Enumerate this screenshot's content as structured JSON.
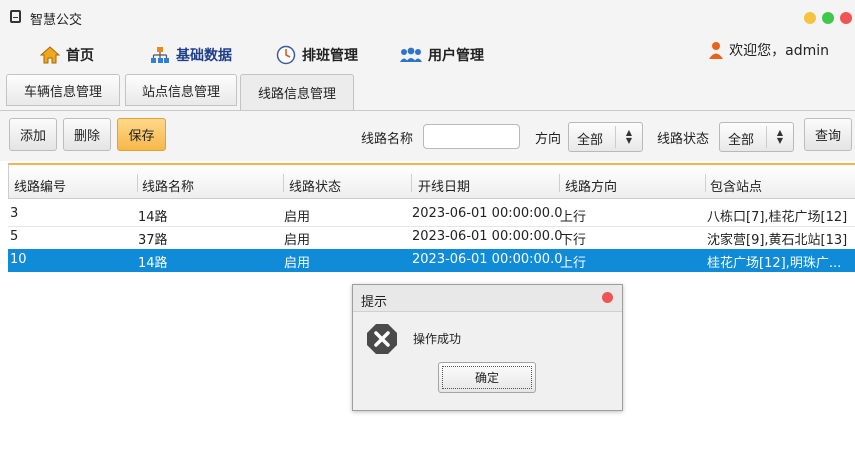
{
  "window": {
    "title": "智慧公交"
  },
  "nav": {
    "items": [
      {
        "label": "首页",
        "icon": "home-icon"
      },
      {
        "label": "基础数据",
        "icon": "sitemap-icon"
      },
      {
        "label": "排班管理",
        "icon": "clock-icon"
      },
      {
        "label": "用户管理",
        "icon": "users-icon"
      }
    ],
    "welcome": "欢迎您，admin"
  },
  "subtabs": [
    {
      "label": "车辆信息管理"
    },
    {
      "label": "站点信息管理"
    },
    {
      "label": "线路信息管理",
      "active": true
    }
  ],
  "toolbar": {
    "add_label": "添加",
    "delete_label": "删除",
    "save_label": "保存",
    "route_name_label": "线路名称",
    "route_name_value": "",
    "direction_label": "方向",
    "direction_value": "全部",
    "status_label": "线路状态",
    "status_value": "全部",
    "query_label": "查询"
  },
  "table": {
    "columns": [
      "线路编号",
      "线路名称",
      "线路状态",
      "开线日期",
      "线路方向",
      "包含站点"
    ],
    "rows": [
      [
        "3",
        "14路",
        "启用",
        "2023-06-01 00:00:00.0",
        "上行",
        "八栋口[7],桂花广场[12]"
      ],
      [
        "5",
        "37路",
        "启用",
        "2023-06-01 00:00:00.0",
        "下行",
        "沈家营[9],黄石北站[13]"
      ],
      [
        "10",
        "14路",
        "启用",
        "2023-06-01 00:00:00.0",
        "上行",
        "桂花广场[12],明珠广..."
      ]
    ],
    "selected_row": 2
  },
  "dialog": {
    "title": "提示",
    "message": "操作成功",
    "ok_label": "确定",
    "icon": "error-x-icon"
  },
  "colors": {
    "accent_orange": "#f6b74a",
    "selection_blue": "#0f8bd8",
    "close_red": "#f05454",
    "min_yellow": "#f5c242",
    "max_green": "#3fc84b"
  }
}
